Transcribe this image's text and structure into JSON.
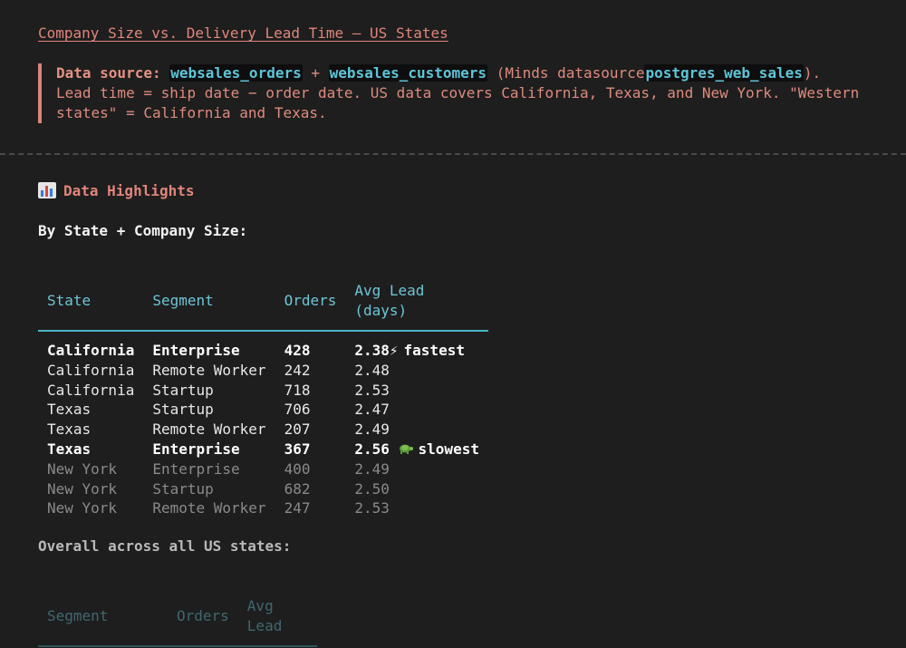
{
  "title_link": "Company Size vs. Delivery Lead Time — US States",
  "note": {
    "lead": "Data source:",
    "table1": "websales_orders",
    "plus": "+",
    "table2": "websales_customers",
    "minds_prefix": "(Minds datasource",
    "datasource": "postgres_web_sales",
    "minds_suffix": ").",
    "line2": "Lead time = ship date − order date. US data covers California, Texas, and New York. \"Western states\" = California and Texas."
  },
  "highlights": {
    "heading": "Data Highlights",
    "icon": "bar-chart-icon",
    "subheading": "By State + Company Size:",
    "columns": [
      "State",
      "Segment",
      "Orders",
      "Avg Lead (days)"
    ],
    "rows": [
      {
        "state": "California",
        "segment": "Enterprise",
        "orders": "428",
        "lead": "2.38",
        "flag": "⚡",
        "flag_label": "fastest",
        "style": "bold"
      },
      {
        "state": "California",
        "segment": "Remote Worker",
        "orders": "242",
        "lead": "2.48",
        "flag": "",
        "flag_label": "",
        "style": "normal"
      },
      {
        "state": "California",
        "segment": "Startup",
        "orders": "718",
        "lead": "2.53",
        "flag": "",
        "flag_label": "",
        "style": "normal"
      },
      {
        "state": "Texas",
        "segment": "Startup",
        "orders": "706",
        "lead": "2.47",
        "flag": "",
        "flag_label": "",
        "style": "normal"
      },
      {
        "state": "Texas",
        "segment": "Remote Worker",
        "orders": "207",
        "lead": "2.49",
        "flag": "",
        "flag_label": "",
        "style": "normal"
      },
      {
        "state": "Texas",
        "segment": "Enterprise",
        "orders": "367",
        "lead": "2.56",
        "flag": "turtle-icon",
        "flag_label": "slowest",
        "style": "bold"
      },
      {
        "state": "New York",
        "segment": "Enterprise",
        "orders": "400",
        "lead": "2.49",
        "flag": "",
        "flag_label": "",
        "style": "dim"
      },
      {
        "state": "New York",
        "segment": "Startup",
        "orders": "682",
        "lead": "2.50",
        "flag": "",
        "flag_label": "",
        "style": "dim"
      },
      {
        "state": "New York",
        "segment": "Remote Worker",
        "orders": "247",
        "lead": "2.53",
        "flag": "",
        "flag_label": "",
        "style": "dim"
      }
    ]
  },
  "overall": {
    "heading": "Overall across all US states:",
    "columns": [
      "Segment",
      "Orders",
      "Avg Lead"
    ]
  },
  "colors": {
    "background": "#1e1e1e",
    "accent_salmon": "#e0857a",
    "accent_cyan": "#6cc6d6"
  }
}
